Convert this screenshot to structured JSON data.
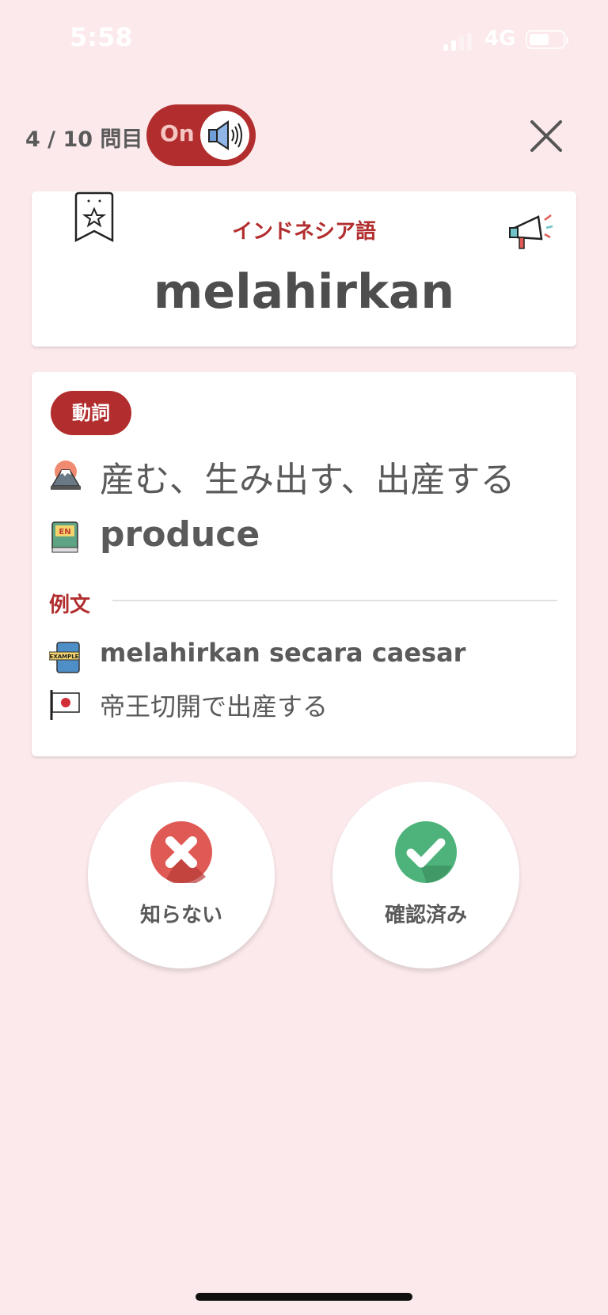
{
  "status_bar": {
    "time": "5:58",
    "network": "4G"
  },
  "header": {
    "progress": "4 / 10 問目",
    "sound_toggle_label": "On"
  },
  "word_card": {
    "language": "インドネシア語",
    "word": "melahirkan"
  },
  "definition": {
    "part_of_speech": "動詞",
    "meaning_ja": "産む、生み出す、出産する",
    "meaning_en": "produce",
    "example_label": "例文",
    "example_id": "melahirkan secara caesar",
    "example_ja": "帝王切開で出産する"
  },
  "buttons": {
    "unknown": "知らない",
    "known": "確認済み"
  },
  "colors": {
    "background": "#fbe9eb",
    "accent": "#b22d2e",
    "red_icon": "#e05a55",
    "green_icon": "#4db37a"
  },
  "icons": [
    "bookmark-star-icon",
    "megaphone-icon",
    "speaker-icon",
    "fuji-icon",
    "english-book-icon",
    "example-book-icon",
    "japan-flag-icon",
    "x-icon",
    "check-icon",
    "close-icon"
  ]
}
